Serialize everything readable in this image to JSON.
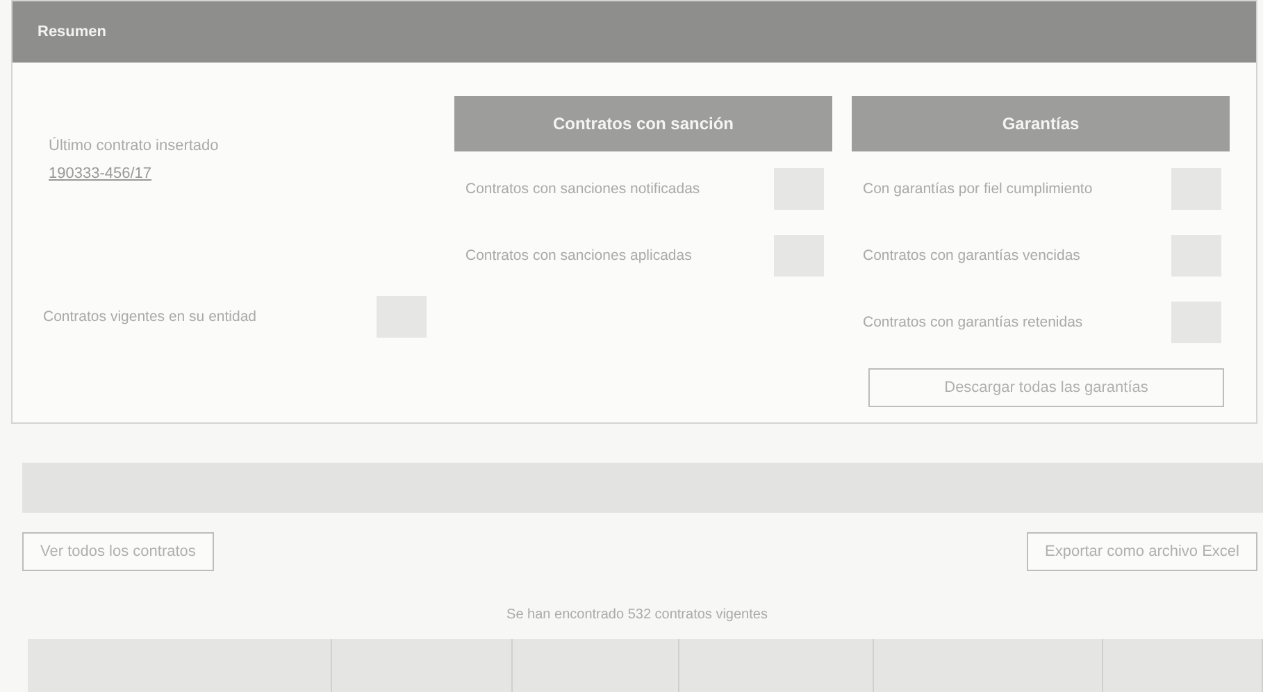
{
  "summary": {
    "title": "Resumen",
    "last_contract": {
      "label": "Último contrato insertado",
      "link": "190333-456/17"
    },
    "vigentes": {
      "label": "Contratos vigentes en su entidad"
    },
    "panels": [
      {
        "title": "Contratos con sanción",
        "rows": [
          "Contratos con sanciones notificadas",
          "Contratos con sanciones aplicadas"
        ]
      },
      {
        "title": "Garantías",
        "rows": [
          "Con garantías por fiel cumplimiento",
          "Contratos con garantías vencidas",
          "Contratos con garantías retenidas"
        ],
        "button": "Descargar todas las garantías"
      }
    ]
  },
  "contracts": {
    "view_all_button": "Ver todos los contratos",
    "export_button": "Exportar como archivo Excel",
    "result_text": "Se han encontrado 532 contratos vigentes"
  }
}
